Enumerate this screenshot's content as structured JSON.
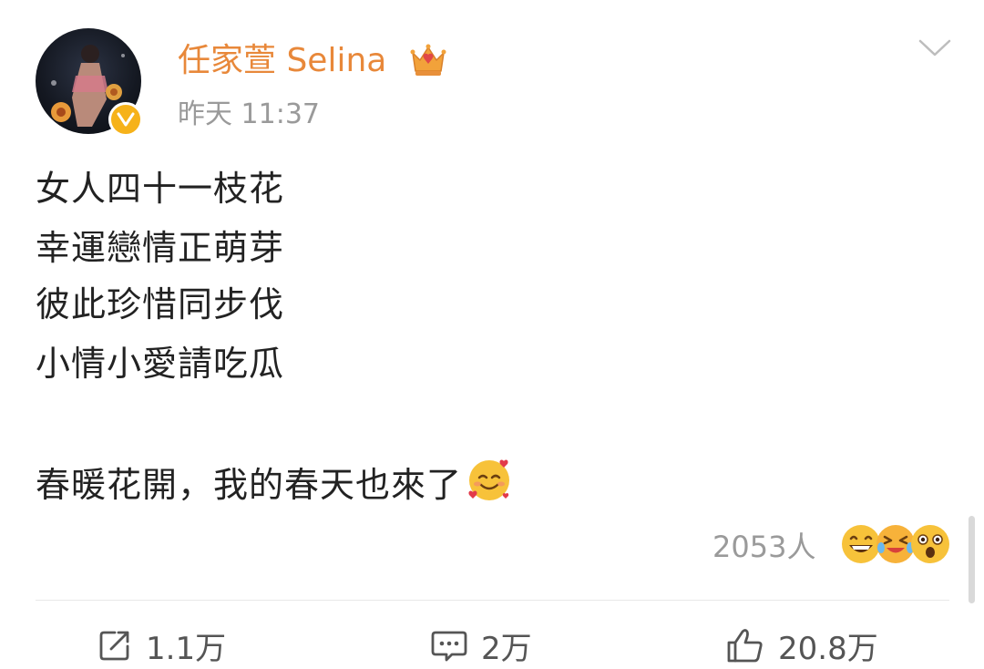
{
  "post": {
    "author": {
      "name": "任家萱 Selina",
      "avatar": "avatar",
      "badge": "verified-badge-icon",
      "vip_icon": "crown-icon"
    },
    "timestamp": "昨天 11:37",
    "content_lines": [
      "女人四十一枝花",
      "幸運戀情正萌芽",
      "彼此珍惜同步伐",
      "小情小愛請吃瓜",
      "",
      "春暖花開，我的春天也來了"
    ],
    "content_emoji": "smiling-face-with-hearts-icon",
    "reactions": {
      "count": "2053人",
      "emojis": [
        "grinning-face-icon",
        "laughing-tears-icon",
        "astonished-face-icon"
      ]
    },
    "actions": {
      "repost": "1.1万",
      "comment": "2万",
      "like": "20.8万"
    }
  },
  "colors": {
    "username": "#e8883a",
    "meta": "#9a9a9a",
    "text": "#222222",
    "verified": "#f6b21a"
  }
}
